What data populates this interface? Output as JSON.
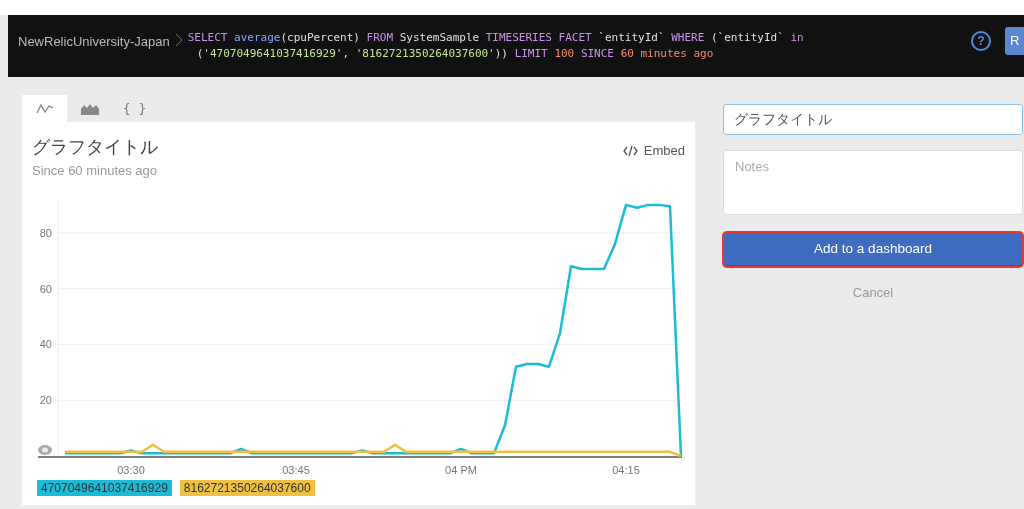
{
  "query_bar": {
    "account": "NewRelicUniversity-Japan",
    "lines": [
      [
        {
          "text": "SELECT ",
          "kind": "keyword"
        },
        {
          "text": "average",
          "kind": "function"
        },
        {
          "text": "(cpuPercent) ",
          "kind": "plain"
        },
        {
          "text": "FROM ",
          "kind": "keyword"
        },
        {
          "text": "SystemSample ",
          "kind": "plain"
        },
        {
          "text": "TIMESERIES FACET ",
          "kind": "keyword"
        },
        {
          "text": "`entityId` ",
          "kind": "plain"
        },
        {
          "text": "WHERE ",
          "kind": "keyword"
        },
        {
          "text": "(`entityId` ",
          "kind": "plain"
        },
        {
          "text": "in",
          "kind": "keyword"
        }
      ],
      [
        {
          "text": "(",
          "kind": "plain"
        },
        {
          "text": "'4707049641037416929'",
          "kind": "string"
        },
        {
          "text": ", ",
          "kind": "plain"
        },
        {
          "text": "'8162721350264037600'",
          "kind": "string"
        },
        {
          "text": ")) ",
          "kind": "plain"
        },
        {
          "text": "LIMIT ",
          "kind": "keyword"
        },
        {
          "text": "100 ",
          "kind": "number"
        },
        {
          "text": "SINCE ",
          "kind": "keyword"
        },
        {
          "text": "60 minutes ago",
          "kind": "number"
        }
      ]
    ],
    "help": "?",
    "run_button": "R"
  },
  "tabs": [
    {
      "kind": "line",
      "selected": true
    },
    {
      "kind": "area",
      "selected": false
    },
    {
      "kind": "json",
      "label": "{ }",
      "selected": false
    }
  ],
  "chart_card": {
    "title": "グラフタイトル",
    "subtitle": "Since 60 minutes ago",
    "embed": "Embed",
    "chart_data": {
      "type": "line",
      "categories": [
        null,
        null,
        null,
        null,
        null,
        null,
        "03:30",
        null,
        null,
        null,
        null,
        null,
        null,
        null,
        null,
        null,
        null,
        null,
        null,
        null,
        null,
        "03:45",
        null,
        null,
        null,
        null,
        null,
        null,
        null,
        null,
        null,
        null,
        null,
        null,
        null,
        null,
        "04 PM",
        null,
        null,
        null,
        null,
        null,
        null,
        null,
        null,
        null,
        null,
        null,
        null,
        null,
        null,
        "04:15",
        null,
        null,
        null,
        null,
        null
      ],
      "ylim": [
        0,
        92
      ],
      "grid": true,
      "yticks": [
        20,
        40,
        60,
        80
      ],
      "series": [
        {
          "name": "4707049641037416929",
          "color": "#1cbbd8",
          "values": [
            1,
            1,
            1,
            1,
            1,
            1,
            2,
            1,
            1,
            1,
            1,
            1,
            1,
            1,
            1,
            1,
            2.5,
            1,
            1,
            1,
            1,
            1,
            1,
            1,
            1,
            1,
            1,
            2,
            1,
            1,
            1,
            1,
            1,
            1,
            1,
            1,
            2.5,
            1,
            1,
            1,
            11,
            32,
            33,
            33,
            32,
            44,
            68,
            67,
            67,
            67,
            76,
            90,
            89,
            90,
            90,
            89.5,
            0
          ]
        },
        {
          "name": "8162721350264037600",
          "color": "#f0c040",
          "values": [
            1.5,
            1.5,
            1.5,
            1.5,
            1.5,
            1.5,
            1.5,
            1.5,
            4,
            1.5,
            1.5,
            1.5,
            1.5,
            1.5,
            1.5,
            1.5,
            1.5,
            1.5,
            1.5,
            1.5,
            1.5,
            1.5,
            1.5,
            1.5,
            1.5,
            1.5,
            1.5,
            1.5,
            1.5,
            1.5,
            4,
            1.5,
            1.5,
            1.5,
            1.5,
            1.5,
            1.5,
            1.5,
            1.5,
            1.5,
            1.5,
            1.5,
            1.5,
            1.5,
            1.5,
            1.5,
            1.5,
            1.5,
            1.5,
            1.5,
            1.5,
            1.5,
            1.5,
            1.5,
            1.5,
            1.5,
            0
          ]
        }
      ]
    }
  },
  "form": {
    "title_value": "グラフタイトル",
    "notes_placeholder": "Notes",
    "add_button": "Add to a dashboard",
    "cancel": "Cancel"
  }
}
